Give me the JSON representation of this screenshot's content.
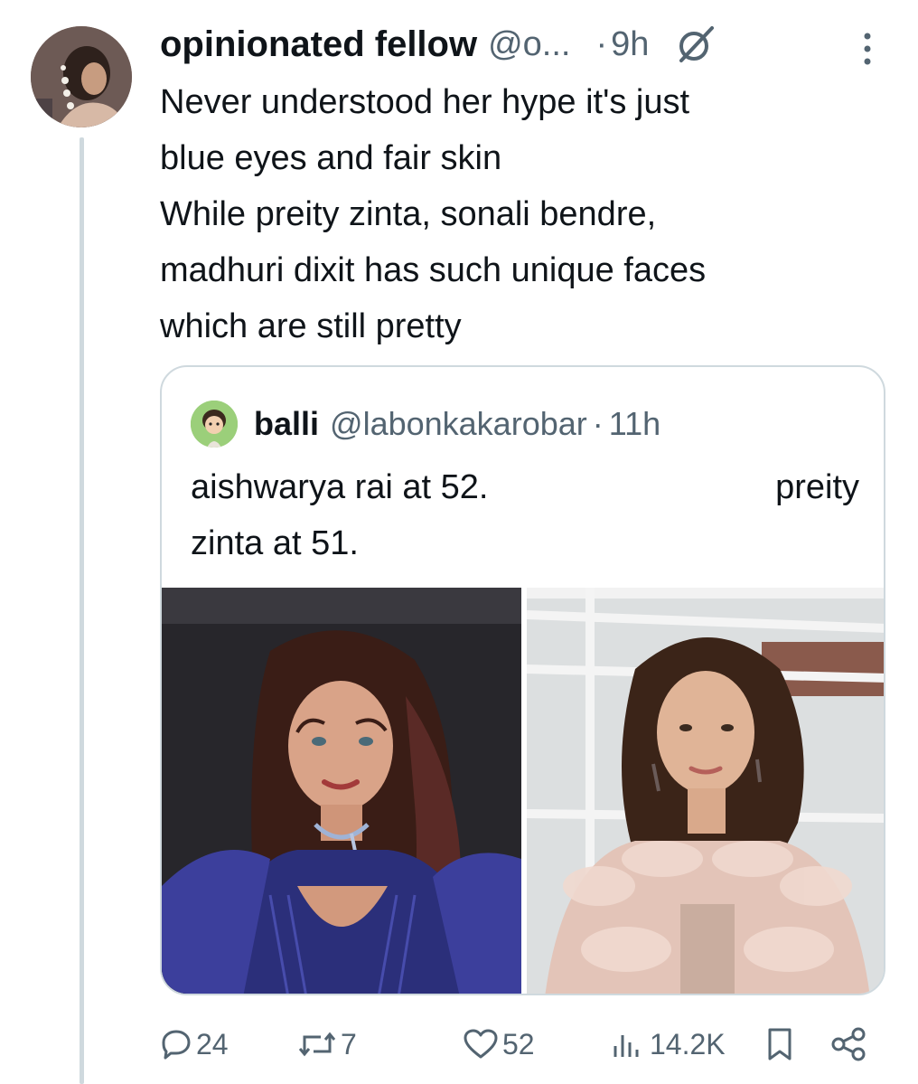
{
  "tweet": {
    "display_name": "opinionated fellow",
    "handle": "@o...",
    "dot": "·",
    "time": "9h",
    "text_lines": [
      "Never understood her hype it's just",
      "blue eyes and fair skin",
      "While preity zinta, sonali bendre,",
      "madhuri dixit has such unique faces",
      "which are still pretty"
    ]
  },
  "quote": {
    "display_name": "balli",
    "handle": "@labonkakarobar",
    "dot": "·",
    "time": "11h",
    "line1_left": "aishwarya rai at 52.",
    "line1_right": "preity",
    "line2": "zinta at 51."
  },
  "actions": {
    "replies": "24",
    "reposts": "7",
    "likes": "52",
    "views": "14.2K"
  },
  "icons": {
    "grok": "grok-icon",
    "more": "more-vertical-icon",
    "reply": "reply-icon",
    "repost": "repost-icon",
    "like": "heart-icon",
    "views": "views-icon",
    "bookmark": "bookmark-icon",
    "share": "share-icon"
  },
  "colors": {
    "text": "#0f1419",
    "secondary": "#536471",
    "border": "#cfd9de"
  }
}
